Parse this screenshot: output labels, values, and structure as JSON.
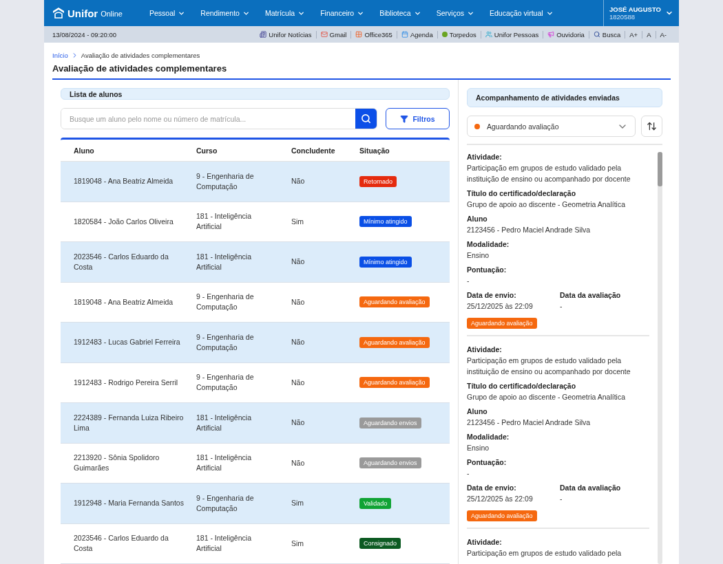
{
  "header": {
    "logo": {
      "name": "Unifor",
      "suffix": "Online"
    },
    "nav": [
      "Pessoal",
      "Rendimento",
      "Matrícula",
      "Financeiro",
      "Biblioteca",
      "Serviços",
      "Educação virtual"
    ],
    "user": {
      "name": "JOSÉ AUGUSTO",
      "id": "1820588"
    }
  },
  "subbar": {
    "datetime": "13/08/2024 - 09:20:00",
    "links": [
      {
        "label": "Unifor Notícias",
        "kind": "news"
      },
      {
        "label": "Gmail",
        "kind": "mail"
      },
      {
        "label": "Office365",
        "kind": "office"
      },
      {
        "label": "Agenda",
        "kind": "calendar"
      },
      {
        "label": "Torpedos",
        "kind": "dot"
      },
      {
        "label": "Unifor Pessoas",
        "kind": "people"
      },
      {
        "label": "Ouvidoria",
        "kind": "megaphone"
      },
      {
        "label": "Busca",
        "kind": "search"
      },
      {
        "label": "A+",
        "kind": "text"
      },
      {
        "label": "A",
        "kind": "text"
      },
      {
        "label": "A-",
        "kind": "text"
      }
    ]
  },
  "breadcrumb": [
    "Início",
    "Avaliação de atividades complementares"
  ],
  "page_title": "Avaliação de atividades complementares",
  "students": {
    "title": "Lista de alunos",
    "search": {
      "placeholder": "Busque um aluno pelo nome ou número de matrícula..."
    },
    "filter_button": "Filtros",
    "columns": [
      "Aluno",
      "Curso",
      "Concludente",
      "Situação"
    ],
    "rows": [
      {
        "student": "1819048 - Ana Beatriz Almeida",
        "course": "9 - Engenharia de Computação",
        "graduating": "Não",
        "status": "Retornado",
        "color": "#e52b0e"
      },
      {
        "student": "1820584 - João Carlos Oliveira",
        "course": "181 - Inteligência Artificial",
        "graduating": "Sim",
        "status": "Mínimo atingido",
        "color": "#0a4fe6"
      },
      {
        "student": "2023546 - Carlos Eduardo da Costa",
        "course": "181 - Inteligência Artificial",
        "graduating": "Não",
        "status": "Mínimo atingido",
        "color": "#0a4fe6"
      },
      {
        "student": "1819048 - Ana Beatriz Almeida",
        "course": "9 - Engenharia de Computação",
        "graduating": "Não",
        "status": "Aguardando avaliação",
        "color": "#f5680f"
      },
      {
        "student": "1912483 - Lucas Gabriel Ferreira",
        "course": "9 - Engenharia de Computação",
        "graduating": "Não",
        "status": "Aguardando avaliação",
        "color": "#f5680f"
      },
      {
        "student": "1912483 - Rodrigo Pereira Serril",
        "course": "9 - Engenharia de Computação",
        "graduating": "Não",
        "status": "Aguardando avaliação",
        "color": "#f5680f"
      },
      {
        "student": "2224389 - Fernanda Luiza Ribeiro Lima",
        "course": "181 - Inteligência Artificial",
        "graduating": "Não",
        "status": "Aguardando envios",
        "color": "#9a9a9a"
      },
      {
        "student": "2213920 - Sônia Spolidoro Guimarães",
        "course": "181 - Inteligência Artificial",
        "graduating": "Não",
        "status": "Aguardando envios",
        "color": "#9a9a9a"
      },
      {
        "student": "1912948 - Maria Fernanda Santos",
        "course": "9 - Engenharia de Computação",
        "graduating": "Sim",
        "status": "Validado",
        "color": "#10a334"
      },
      {
        "student": "2023546 - Carlos Eduardo da Costa",
        "course": "181 - Inteligência Artificial",
        "graduating": "Sim",
        "status": "Consignado",
        "color": "#0c5a22"
      }
    ]
  },
  "tracking": {
    "title": "Acompanhamento de atividades enviadas",
    "select": {
      "value": "Aguardando avaliação",
      "color": "#f5680f"
    },
    "cards": [
      {
        "fields": [
          {
            "label": "Atividade:",
            "value": "Participação em grupos de estudo validado pela instituição de ensino ou acompanhado por docente"
          },
          {
            "label": "Título do certificado/declaração",
            "value": "Grupo de apoio ao discente - Geometria Analítica"
          },
          {
            "label": "Aluno",
            "value": "2123456 - Pedro Maciel Andrade Silva"
          },
          {
            "label": "Modalidade:",
            "value": "Ensino"
          },
          {
            "label": "Pontuação:",
            "value": "-"
          }
        ],
        "dates": [
          {
            "label": "Data de envio:",
            "value": "25/12/2025 às 22:09"
          },
          {
            "label": "Data da avaliação",
            "value": "-"
          }
        ],
        "status": {
          "label": "Aguardando avaliação",
          "color": "#f5680f"
        }
      },
      {
        "fields": [
          {
            "label": "Atividade:",
            "value": "Participação em grupos de estudo validado pela instituição de ensino ou acompanhado por docente"
          },
          {
            "label": "Título do certificado/declaração",
            "value": "Grupo de apoio ao discente - Geometria Analítica"
          },
          {
            "label": "Aluno",
            "value": "2123456 - Pedro Maciel Andrade Silva"
          },
          {
            "label": "Modalidade:",
            "value": "Ensino"
          },
          {
            "label": "Pontuação:",
            "value": "-"
          }
        ],
        "dates": [
          {
            "label": "Data de envio:",
            "value": "25/12/2025 às 22:09"
          },
          {
            "label": "Data da avaliação",
            "value": "-"
          }
        ],
        "status": {
          "label": "Aguardando avaliação",
          "color": "#f5680f"
        }
      },
      {
        "fields": [
          {
            "label": "Atividade:",
            "value": "Participação em grupos de estudo validado pela"
          }
        ]
      }
    ]
  }
}
